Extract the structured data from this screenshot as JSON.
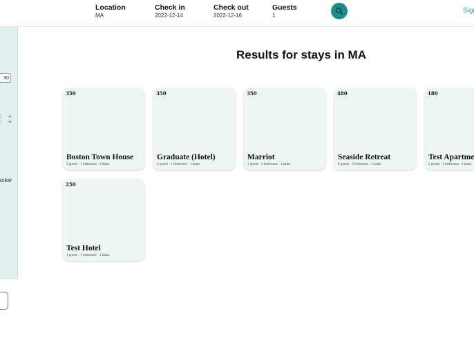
{
  "header": {
    "location": {
      "label": "Location",
      "value": "MA"
    },
    "checkin": {
      "label": "Check in",
      "value": "2022-12-14"
    },
    "checkout": {
      "label": "Check out",
      "value": "2022-12-16"
    },
    "guests": {
      "label": "Guests",
      "value": "1"
    },
    "signin_label": "Sign",
    "accent": "#1f8b8b"
  },
  "sidebar": {
    "price_max": "90",
    "stepper_plus": "+",
    "text_1": "acker",
    "text_2": "t"
  },
  "results": {
    "title": "Results for stays in MA",
    "listings": [
      {
        "price": "350",
        "name": "Boston Town House",
        "details": "3 guests · 3 bedrooms · 2 baths"
      },
      {
        "price": "350",
        "name": "Graduate (Hotel)",
        "details": "2 guests · 1 bedrooms · 1 baths"
      },
      {
        "price": "350",
        "name": "Marriot",
        "details": "1 guests · 1 bedrooms · 1 baths"
      },
      {
        "price": "480",
        "name": "Seaside Retreat",
        "details": "8 guests · 4 bedrooms · 3 baths"
      },
      {
        "price": "180",
        "name": "Test Apartment",
        "details": "2 guests · 1 bedrooms · 1 baths"
      },
      {
        "price": "250",
        "name": "Test Hotel",
        "details": "1 guests · 1 bedrooms · 1 baths"
      }
    ]
  }
}
